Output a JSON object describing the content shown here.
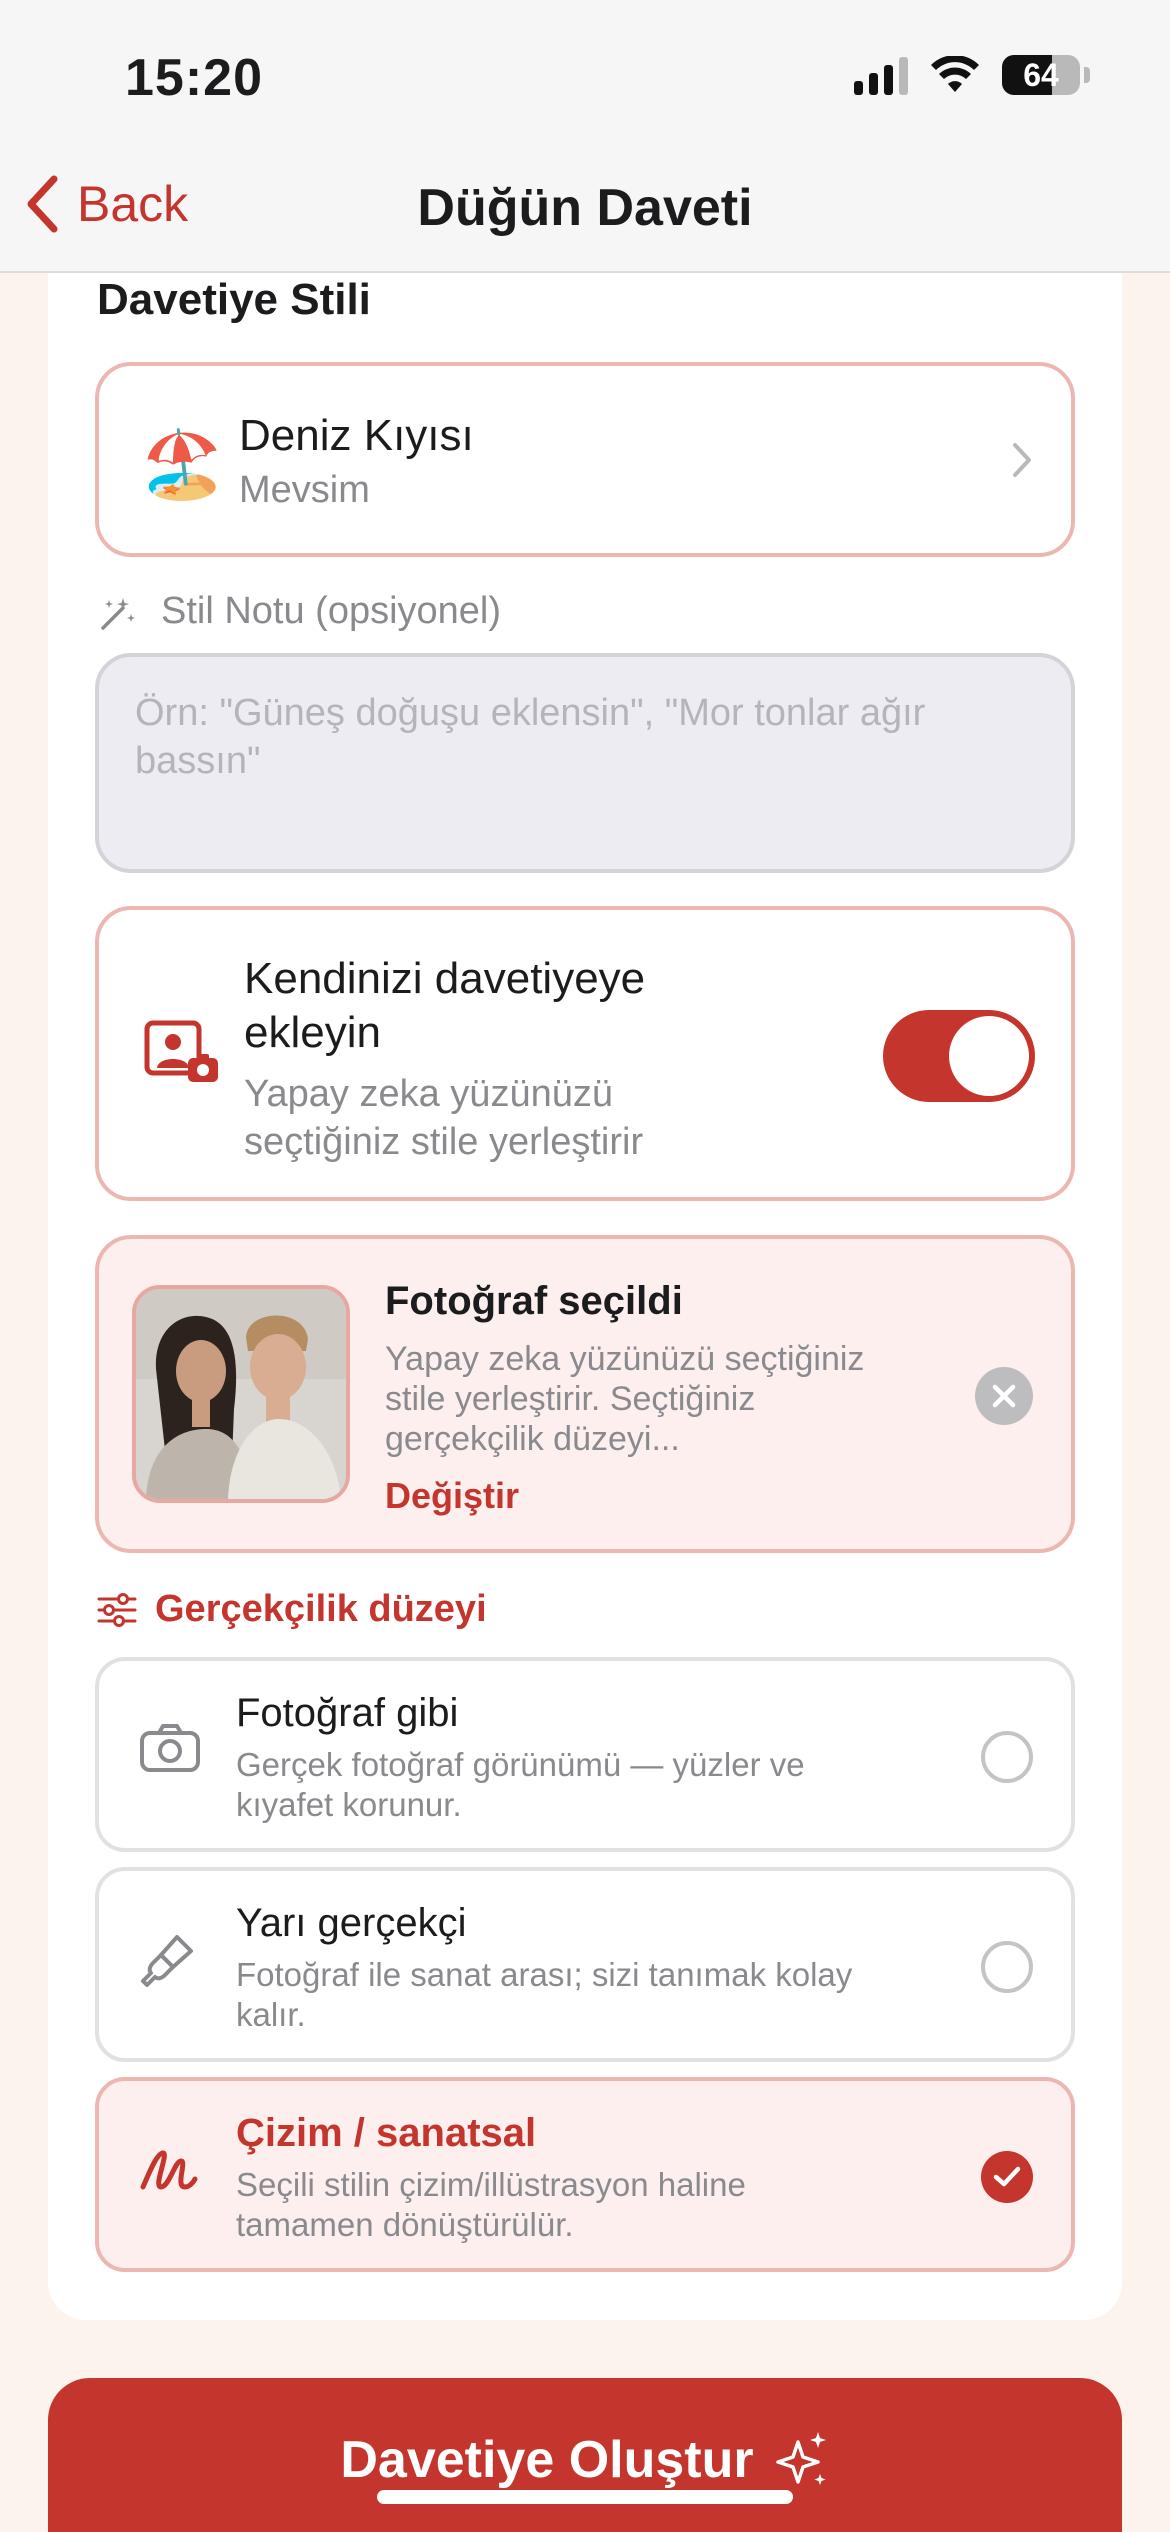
{
  "status_bar": {
    "time": "15:20",
    "battery": "64"
  },
  "nav": {
    "back_label": "Back",
    "title": "Düğün Daveti"
  },
  "invitation_style": {
    "section_title": "Davetiye Stili",
    "style_emoji": "🏖️",
    "style_name": "Deniz Kıyısı",
    "style_category": "Mevsim"
  },
  "style_note": {
    "label": "Stil Notu (opsiyonel)",
    "placeholder": "Örn: \"Güneş doğuşu eklensin\", \"Mor tonlar ağır bassın\"",
    "value": ""
  },
  "add_self": {
    "title": "Kendinizi davetiyeye ekleyin",
    "subtitle": "Yapay zeka yüzünüzü seçtiğiniz stile yerleştirir",
    "enabled": true
  },
  "photo": {
    "title": "Fotoğraf seçildi",
    "description": "Yapay zeka yüzünüzü seçtiğiniz stile yerleştirir. Seçtiğiniz gerçekçilik düzeyi...",
    "change_label": "Değiştir"
  },
  "realism": {
    "label": "Gerçekçilik düzeyi",
    "options": [
      {
        "title": "Fotoğraf gibi",
        "subtitle": "Gerçek fotoğraf görünümü — yüzler ve kıyafet korunur.",
        "icon": "camera-icon",
        "selected": false
      },
      {
        "title": "Yarı gerçekçi",
        "subtitle": "Fotoğraf ile sanat arası; sizi tanımak kolay kalır.",
        "icon": "paintbrush-icon",
        "selected": false
      },
      {
        "title": "Çizim / sanatsal",
        "subtitle": "Seçili stilin çizim/illüstrasyon haline tamamen dönüştürülür.",
        "icon": "scribble-icon",
        "selected": true
      }
    ]
  },
  "cta": {
    "label": "Davetiye Oluştur",
    "icon": "sparkles-icon"
  },
  "colors": {
    "accent": "#c4352d",
    "accent_light": "#fcefee",
    "border_accent": "#ecb7b1",
    "background": "#fbf3ec"
  }
}
